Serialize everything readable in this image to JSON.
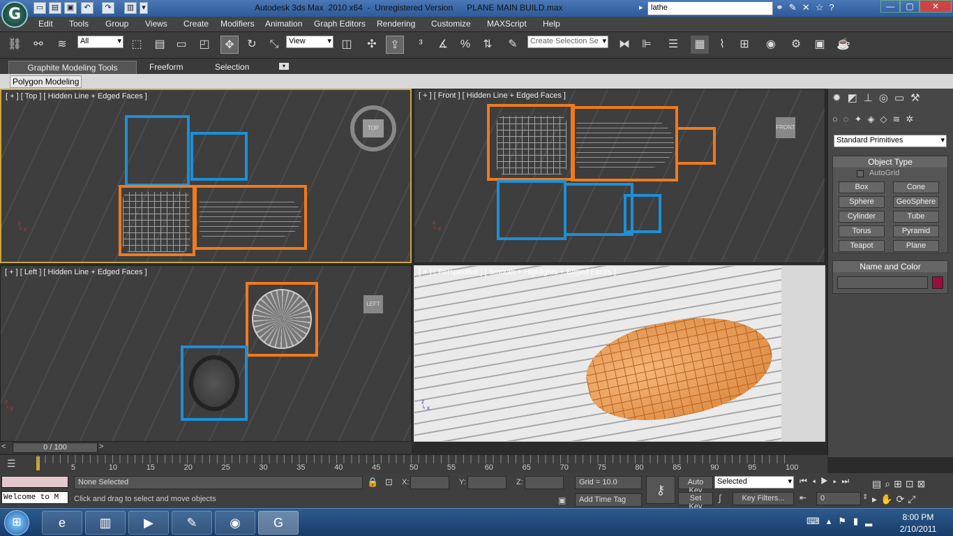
{
  "title": {
    "text": "Autodesk 3ds Max  2010 x64  -  Unregistered Version      PLANE MAIN BUILD.max",
    "search_value": "lathe",
    "minimize": "—",
    "maximize": "▢",
    "close": "✕"
  },
  "menu": [
    "Edit",
    "Tools",
    "Group",
    "Views",
    "Create",
    "Modifiers",
    "Animation",
    "Graph Editors",
    "Rendering",
    "Customize",
    "MAXScript",
    "Help"
  ],
  "toolbar": {
    "filter_value": "All",
    "refcoord_value": "View",
    "selection_set_placeholder": "Create Selection Se"
  },
  "ribbon": {
    "tabs": [
      "Graphite Modeling Tools",
      "Freeform",
      "Selection"
    ],
    "panel_label": "Polygon Modeling"
  },
  "viewports": {
    "top": {
      "label": "[ + ] [ Top ] [ Hidden Line + Edged Faces ]",
      "cube": "TOP"
    },
    "front": {
      "label": "[ + ] [ Front ] [ Hidden Line + Edged Faces ]",
      "cube": "FRONT"
    },
    "left": {
      "label": "[ + ] [ Left ] [ Hidden Line + Edged Faces ]",
      "cube": "LEFT"
    },
    "perspective": {
      "label": "[ + ] [ Perspective ] [ Smooth + Highlights + Edged Faces ]"
    }
  },
  "command_panel": {
    "category": "Standard Primitives",
    "object_type_title": "Object Type",
    "autogrid": "AutoGrid",
    "buttons": [
      "Box",
      "Cone",
      "Sphere",
      "GeoSphere",
      "Cylinder",
      "Tube",
      "Torus",
      "Pyramid",
      "Teapot",
      "Plane"
    ],
    "name_color_title": "Name and Color",
    "swatch_color": "#9b0f3c"
  },
  "timeline": {
    "slider_text": "0 / 100",
    "ticks": [
      "5",
      "10",
      "15",
      "20",
      "25",
      "30",
      "35",
      "40",
      "45",
      "50",
      "55",
      "60",
      "65",
      "70",
      "75",
      "80",
      "85",
      "90",
      "95",
      "100"
    ]
  },
  "status": {
    "listener_text": "Welcome to M",
    "selection": "None Selected",
    "prompt": "Click and drag to select and move objects",
    "x_label": "X:",
    "y_label": "Y:",
    "z_label": "Z:",
    "grid": "Grid = 10.0",
    "add_time_tag": "Add Time Tag",
    "auto_key": "Auto Key",
    "set_key": "Set Key",
    "key_mode_value": "Selected",
    "key_filters": "Key Filters...",
    "frame_value": "0"
  },
  "taskbar": {
    "time": "8:00 PM",
    "date": "2/10/2011"
  },
  "colors": {
    "blue_box": "#1d8fd6",
    "orange_box": "#f07a1e"
  }
}
